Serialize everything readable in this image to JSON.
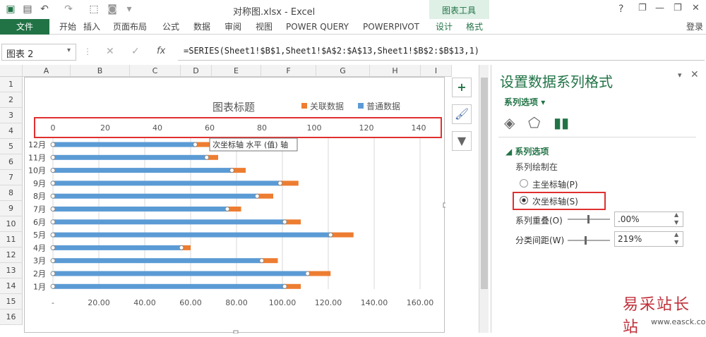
{
  "title_bar": {
    "file_title": "对称图.xlsx - Excel",
    "help": "?",
    "minimize": "—",
    "restore": "❐",
    "close": "✕"
  },
  "ribbon": {
    "file": "文件",
    "tabs": [
      "开始",
      "插入",
      "页面布局",
      "公式",
      "数据",
      "审阅",
      "视图",
      "POWER QUERY",
      "POWERPIVOT",
      "设计",
      "格式"
    ],
    "chart_tools": "图表工具",
    "login": "登录"
  },
  "formula_bar": {
    "name_box": "图表 2",
    "fx": "fx",
    "formula": "=SERIES(Sheet1!$B$1,Sheet1!$A$2:$A$13,Sheet1!$B$2:$B$13,1)"
  },
  "columns": [
    "A",
    "B",
    "C",
    "D",
    "E",
    "F",
    "G",
    "H",
    "I"
  ],
  "rows": [
    "1",
    "2",
    "3",
    "4",
    "5",
    "6",
    "7",
    "8",
    "9",
    "10",
    "11",
    "12",
    "13",
    "14",
    "15",
    "16"
  ],
  "chart_data": {
    "type": "bar",
    "title": "图表标题",
    "categories": [
      "12月",
      "11月",
      "10月",
      "9月",
      "8月",
      "7月",
      "6月",
      "5月",
      "4月",
      "3月",
      "2月",
      "1月"
    ],
    "series": [
      {
        "name": "普通数据",
        "values": [
          62,
          67,
          78,
          99,
          89,
          76,
          101,
          121,
          56,
          91,
          111,
          101
        ],
        "color": "#5b9bd5"
      },
      {
        "name": "关联数据",
        "values": [
          8,
          5,
          6,
          8,
          7,
          6,
          7,
          10,
          4,
          7,
          10,
          7
        ],
        "color": "#ed7d31"
      }
    ],
    "secondary_axis_ticks": [
      "0",
      "20",
      "40",
      "60",
      "80",
      "100",
      "120",
      "140"
    ],
    "primary_axis_ticks": [
      "-",
      "20.00",
      "40.00",
      "60.00",
      "80.00",
      "100.00",
      "120.00",
      "140.00",
      "160.00"
    ],
    "tooltip": "次坐标轴 水平 (值) 轴",
    "legend": "top-right"
  },
  "panel": {
    "title": "设置数据系列格式",
    "series_options": "系列选项",
    "section": "系列选项",
    "plot_on": "系列绘制在",
    "primary_axis": "主坐标轴(P)",
    "secondary_axis": "次坐标轴(S)",
    "overlap_label": "系列重叠(O)",
    "overlap_value": ".00%",
    "gap_label": "分类间距(W)",
    "gap_value": "219%"
  },
  "watermark": {
    "cn": "易采站长站",
    "url": "www.easck.com"
  },
  "colors": {
    "accent": "#217346",
    "highlight": "#e03030",
    "blue": "#5b9bd5",
    "orange": "#ed7d31"
  }
}
